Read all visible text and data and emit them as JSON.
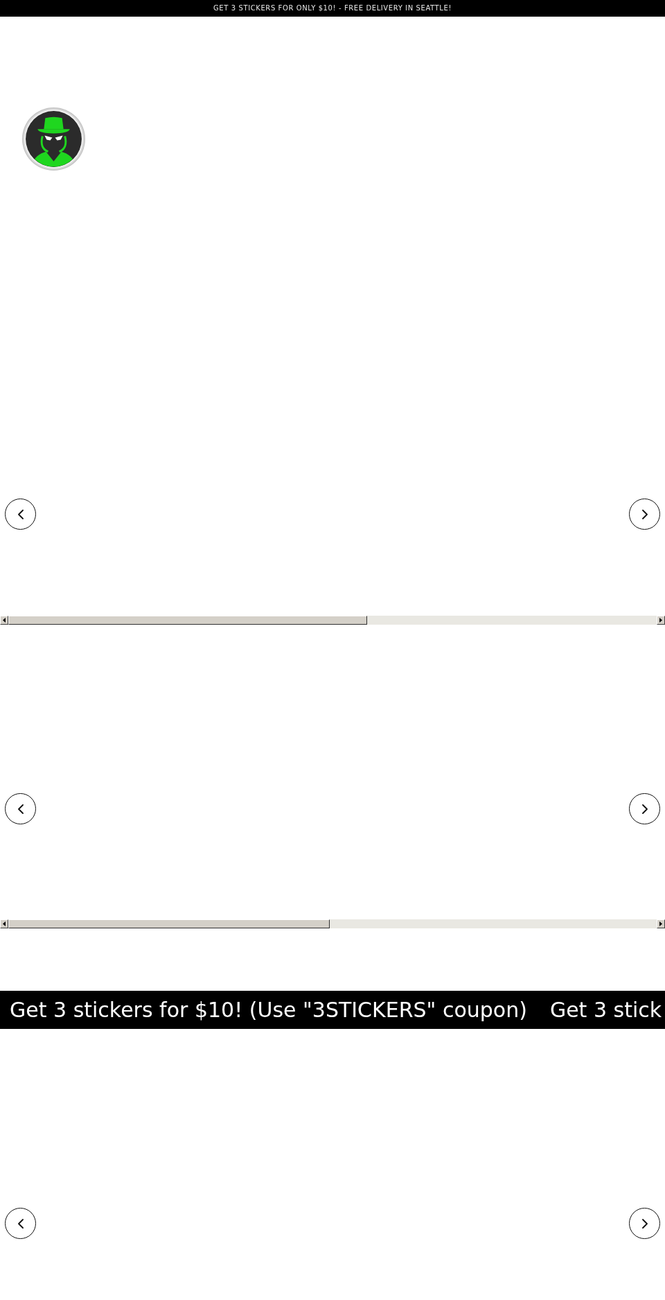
{
  "announcement_bar": {
    "text": "GET 3 STICKERS FOR ONLY $10! - FREE DELIVERY IN SEATTLE!"
  },
  "sections": [
    {
      "kind": "carousel",
      "scrollbar": true
    },
    {
      "kind": "carousel",
      "scrollbar": true
    },
    {
      "kind": "marquee",
      "items": [
        "Get 3 stickers for $10! (Use \"3STICKERS\" coupon)",
        "Get 3 stick"
      ]
    },
    {
      "kind": "carousel",
      "scrollbar": false
    }
  ]
}
